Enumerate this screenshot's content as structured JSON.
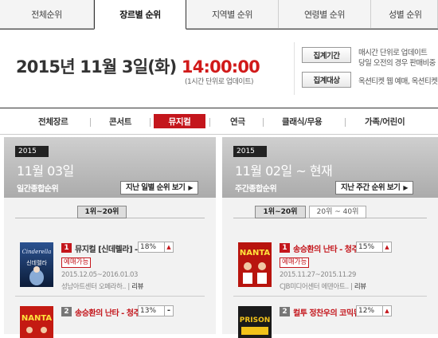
{
  "top_tabs": [
    {
      "label": "전체순위",
      "active": false
    },
    {
      "label": "장르별 순위",
      "active": true
    },
    {
      "label": "지역별 순위",
      "active": false
    },
    {
      "label": "연령별 순위",
      "active": false
    },
    {
      "label": "성별 순위",
      "active": false
    }
  ],
  "date_header": {
    "date": "2015년 11월 3일(화)",
    "time": "14:00:00",
    "note": "(1시간 단위로 업데이트)",
    "buttons": [
      {
        "label": "집계기간",
        "text": "매시간 단위로 업데이트"
      },
      {
        "label": "집계대상",
        "text": "옥션티켓 웹 예매, 옥션티켓"
      }
    ],
    "extra_text": "당일 오전의 경우 판매비중"
  },
  "genres": [
    {
      "label": "전체장르",
      "active": false
    },
    {
      "label": "콘서트",
      "active": false
    },
    {
      "label": "뮤지컬",
      "active": true
    },
    {
      "label": "연극",
      "active": false
    },
    {
      "label": "클래식/무용",
      "active": false
    },
    {
      "label": "가족/어린이",
      "active": false
    }
  ],
  "panels": [
    {
      "year": "2015",
      "date": "11월 03일",
      "subtitle": "일간종합순위",
      "link": "지난 일별 순위 보기",
      "range_tabs": [
        "1위~20위"
      ],
      "items": [
        {
          "rank": "1",
          "title": "뮤지컬 [신데렐라] -",
          "share": "18%",
          "trend": "▲",
          "status": "예매가능",
          "period": "2015.12.05~2016.01.03",
          "venue": "성남아트센터 오페라하..",
          "review": "리뷰"
        },
        {
          "rank": "2",
          "title": "송승환의 난타 - 청주",
          "share": "13%",
          "trend": "-"
        }
      ]
    },
    {
      "year": "2015",
      "date": "11월 02일 ~ 현재",
      "subtitle": "주간종합순위",
      "link": "지난 주간 순위 보기",
      "range_tabs": [
        "1위~20위",
        "20위 ~ 40위"
      ],
      "items": [
        {
          "rank": "1",
          "title": "송승환의 난타 - 청주",
          "share": "15%",
          "trend": "▲",
          "status": "예매가능",
          "period": "2015.11.27~2015.11.29",
          "venue": "CJB미디어센터 에덴아트..",
          "review": "리뷰"
        },
        {
          "rank": "2",
          "title": "컬투 정찬우의 코믹뮤",
          "share": "12%",
          "trend": "▲"
        }
      ]
    }
  ],
  "colors": {
    "accent": "#c4161c",
    "panel_head": "#b8b8b8"
  },
  "icons": {
    "link_arrow": "▶",
    "trend_up": "▲"
  }
}
